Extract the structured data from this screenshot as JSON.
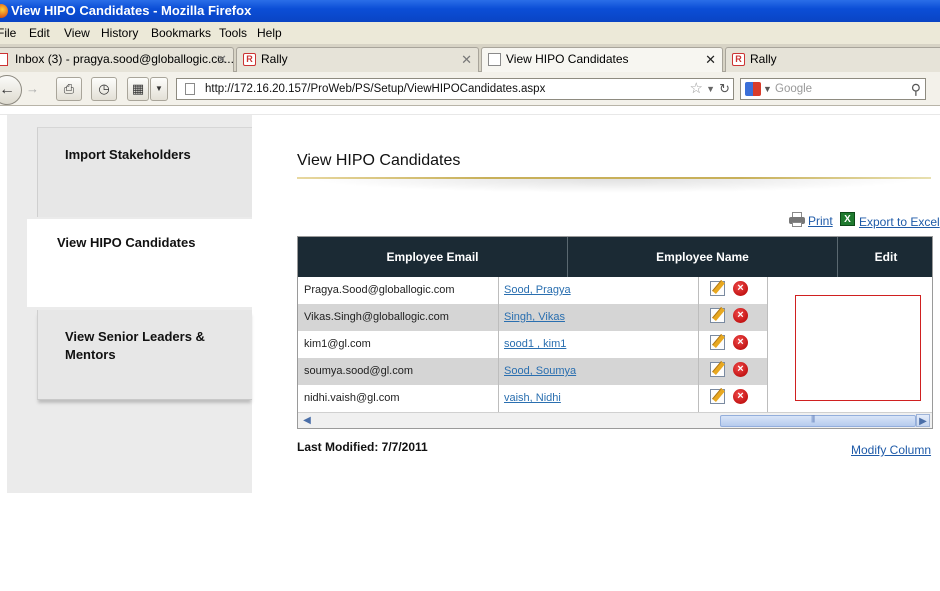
{
  "window": {
    "title": "View HIPO Candidates - Mozilla Firefox"
  },
  "menu": [
    "File",
    "Edit",
    "View",
    "History",
    "Bookmarks",
    "Tools",
    "Help"
  ],
  "tabs": [
    {
      "label": "Inbox (3) - pragya.sood@globallogic.co...",
      "icon": "gmail-icon",
      "active": false
    },
    {
      "label": "Rally",
      "icon": "rally-icon",
      "active": false
    },
    {
      "label": "View HIPO Candidates",
      "icon": "page-icon",
      "active": true
    },
    {
      "label": "Rally",
      "icon": "rally-icon",
      "active": false
    }
  ],
  "navbar": {
    "url": "http://172.16.20.157/ProWeb/PS/Setup/ViewHIPOCandidates.aspx",
    "search_placeholder": "Google"
  },
  "sidebar": {
    "items": [
      {
        "label": "Import Stakeholders",
        "active": false
      },
      {
        "label": "View HIPO Candidates",
        "active": true
      },
      {
        "label": "View Senior Leaders & Mentors",
        "active": false
      }
    ]
  },
  "content": {
    "title": "View HIPO Candidates",
    "print_label": "Print",
    "export_label": "Export to Excel",
    "columns": [
      "Employee Email",
      "Employee Name",
      "Edit"
    ],
    "rows": [
      {
        "email": "Pragya.Sood@globallogic.com",
        "name": "Sood, Pragya"
      },
      {
        "email": "Vikas.Singh@globallogic.com",
        "name": "Singh, Vikas"
      },
      {
        "email": "kim1@gl.com",
        "name": "sood1 , kim1"
      },
      {
        "email": "soumya.sood@gl.com",
        "name": "Sood, Soumya"
      },
      {
        "email": "nidhi.vaish@gl.com",
        "name": "vaish, Nidhi"
      }
    ],
    "last_modified": "Last Modified: 7/7/2011",
    "modify_column_label": "Modify Column"
  },
  "colors": {
    "grid_header": "#1b2a34",
    "link": "#1e5aa8",
    "title_bar": "#0b4ed6",
    "alt_row": "#d5d5d5"
  }
}
